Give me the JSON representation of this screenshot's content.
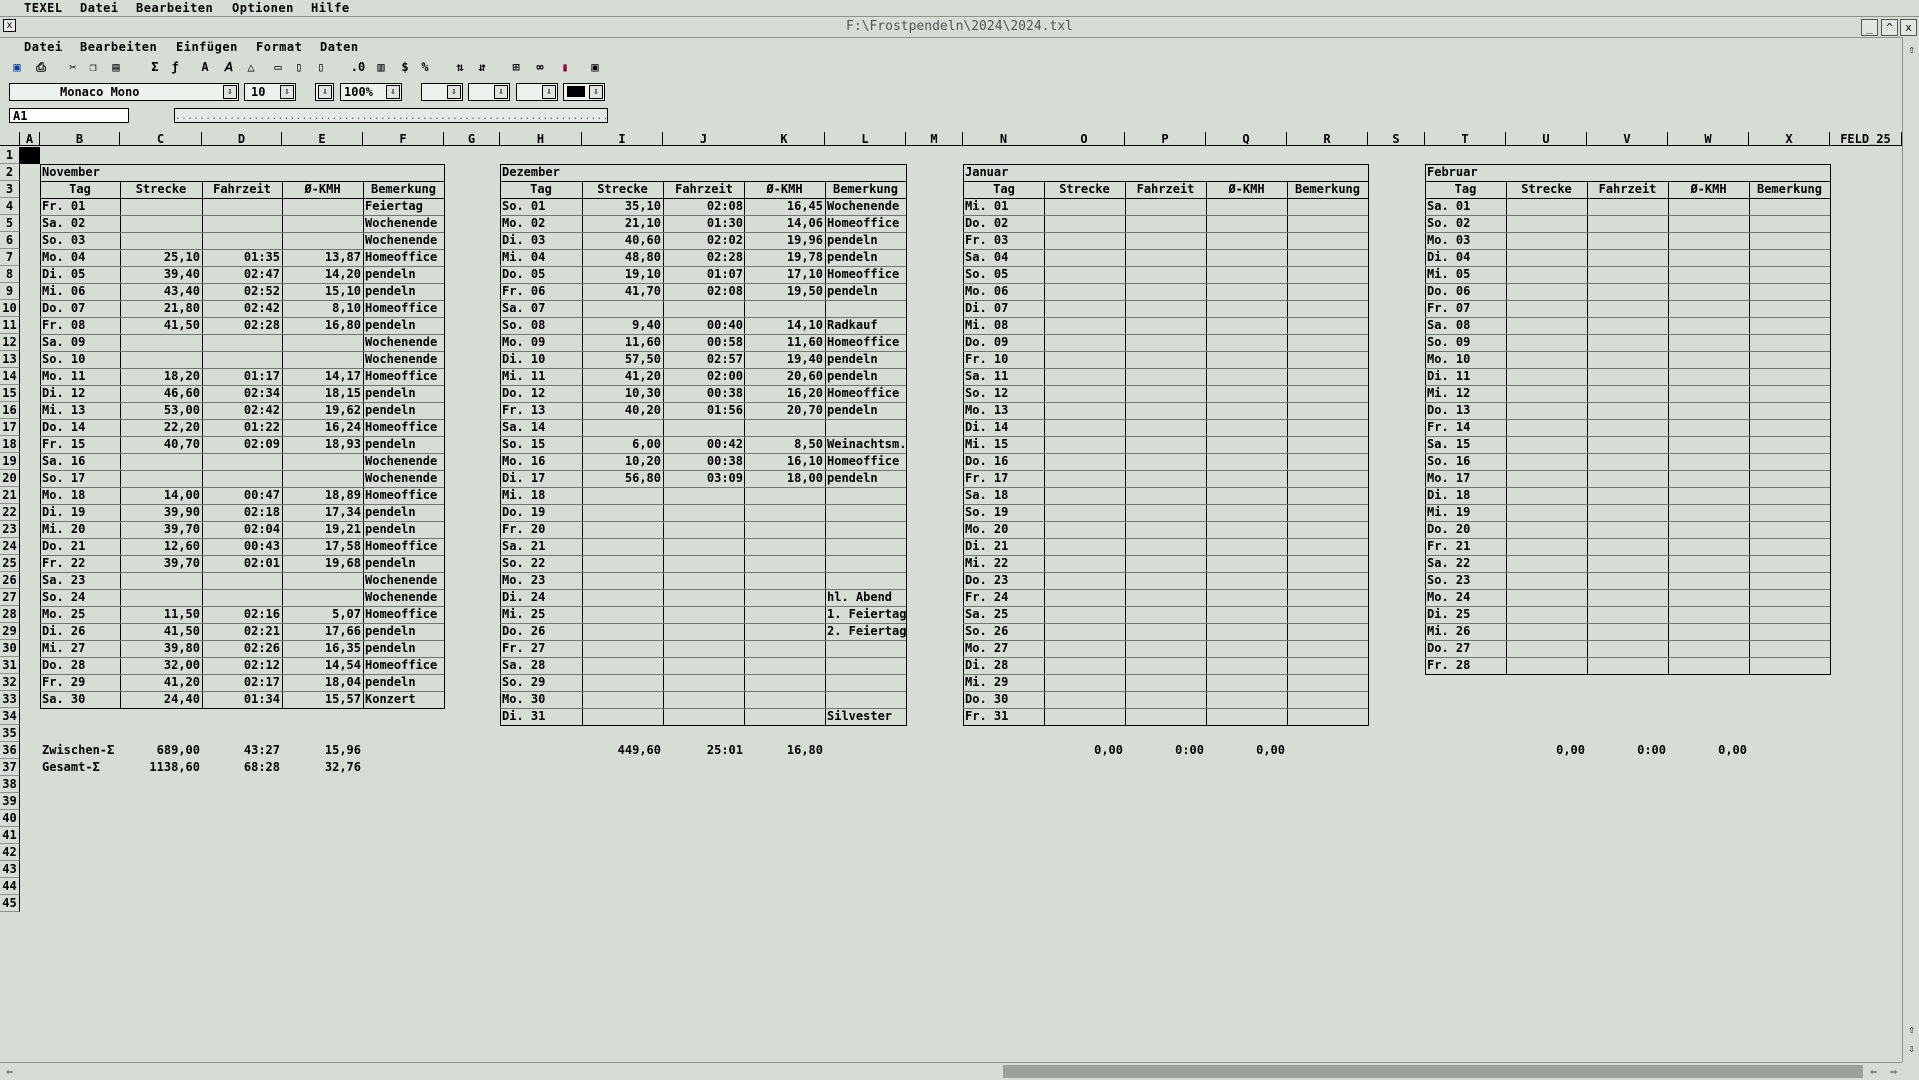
{
  "os_menu": {
    "items": [
      "TEXEL",
      "Datei",
      "Bearbeiten",
      "Optionen",
      "Hilfe"
    ]
  },
  "window": {
    "title": "F:\\Frostpendeln\\2024\\2024.txl",
    "close": "x",
    "min": "_",
    "max": "^",
    "close2": "x"
  },
  "app_menu": {
    "items": [
      "Datei",
      "Bearbeiten",
      "Einfügen",
      "Format",
      "Daten"
    ]
  },
  "format_bar": {
    "font": "Monaco Mono",
    "size": "10",
    "zoom": "100%"
  },
  "cell_ref": "A1",
  "formula_text": "........................................................................................",
  "columns": [
    "A",
    "B",
    "C",
    "D",
    "E",
    "F",
    "G",
    "H",
    "I",
    "J",
    "K",
    "L",
    "M",
    "N",
    "O",
    "P",
    "Q",
    "R",
    "S",
    "T",
    "U",
    "V",
    "W",
    "X",
    "FELD_25"
  ],
  "row_numbers": [
    "1",
    "2",
    "3",
    "4",
    "5",
    "6",
    "7",
    "8",
    "9",
    "10",
    "11",
    "12",
    "13",
    "14",
    "15",
    "16",
    "17",
    "18",
    "19",
    "20",
    "21",
    "22",
    "23",
    "24",
    "25",
    "26",
    "27",
    "28",
    "29",
    "30",
    "31",
    "32",
    "33",
    "34",
    "35",
    "36",
    "37",
    "38",
    "39",
    "40",
    "41",
    "42",
    "43",
    "44",
    "45"
  ],
  "headers": [
    "Tag",
    "Strecke",
    "Fahrzeit",
    "Ø-KMH",
    "Bemerkung"
  ],
  "months": [
    {
      "name": "November",
      "rows": [
        [
          "Fr. 01",
          "",
          "",
          "",
          "Feiertag"
        ],
        [
          "Sa. 02",
          "",
          "",
          "",
          "Wochenende"
        ],
        [
          "So. 03",
          "",
          "",
          "",
          "Wochenende"
        ],
        [
          "Mo. 04",
          "25,10",
          "01:35",
          "13,87",
          "Homeoffice"
        ],
        [
          "Di. 05",
          "39,40",
          "02:47",
          "14,20",
          "pendeln"
        ],
        [
          "Mi. 06",
          "43,40",
          "02:52",
          "15,10",
          "pendeln"
        ],
        [
          "Do. 07",
          "21,80",
          "02:42",
          "8,10",
          "Homeoffice"
        ],
        [
          "Fr. 08",
          "41,50",
          "02:28",
          "16,80",
          "pendeln"
        ],
        [
          "Sa. 09",
          "",
          "",
          "",
          "Wochenende"
        ],
        [
          "So. 10",
          "",
          "",
          "",
          "Wochenende"
        ],
        [
          "Mo. 11",
          "18,20",
          "01:17",
          "14,17",
          "Homeoffice"
        ],
        [
          "Di. 12",
          "46,60",
          "02:34",
          "18,15",
          "pendeln"
        ],
        [
          "Mi. 13",
          "53,00",
          "02:42",
          "19,62",
          "pendeln"
        ],
        [
          "Do. 14",
          "22,20",
          "01:22",
          "16,24",
          "Homeoffice"
        ],
        [
          "Fr. 15",
          "40,70",
          "02:09",
          "18,93",
          "pendeln"
        ],
        [
          "Sa. 16",
          "",
          "",
          "",
          "Wochenende"
        ],
        [
          "So. 17",
          "",
          "",
          "",
          "Wochenende"
        ],
        [
          "Mo. 18",
          "14,00",
          "00:47",
          "18,89",
          "Homeoffice"
        ],
        [
          "Di. 19",
          "39,90",
          "02:18",
          "17,34",
          "pendeln"
        ],
        [
          "Mi. 20",
          "39,70",
          "02:04",
          "19,21",
          "pendeln"
        ],
        [
          "Do. 21",
          "12,60",
          "00:43",
          "17,58",
          "Homeoffice"
        ],
        [
          "Fr. 22",
          "39,70",
          "02:01",
          "19,68",
          "pendeln"
        ],
        [
          "Sa. 23",
          "",
          "",
          "",
          "Wochenende"
        ],
        [
          "So. 24",
          "",
          "",
          "",
          "Wochenende"
        ],
        [
          "Mo. 25",
          "11,50",
          "02:16",
          "5,07",
          "Homeoffice"
        ],
        [
          "Di. 26",
          "41,50",
          "02:21",
          "17,66",
          "pendeln"
        ],
        [
          "Mi. 27",
          "39,80",
          "02:26",
          "16,35",
          "pendeln"
        ],
        [
          "Do. 28",
          "32,00",
          "02:12",
          "14,54",
          "Homeoffice"
        ],
        [
          "Fr. 29",
          "41,20",
          "02:17",
          "18,04",
          "pendeln"
        ],
        [
          "Sa. 30",
          "24,40",
          "01:34",
          "15,57",
          "Konzert"
        ]
      ],
      "zwischen": [
        "689,00",
        "43:27",
        "15,96"
      ],
      "gesamt": [
        "1138,60",
        "68:28",
        "32,76"
      ]
    },
    {
      "name": "Dezember",
      "rows": [
        [
          "So. 01",
          "35,10",
          "02:08",
          "16,45",
          "Wochenende"
        ],
        [
          "Mo. 02",
          "21,10",
          "01:30",
          "14,06",
          "Homeoffice"
        ],
        [
          "Di. 03",
          "40,60",
          "02:02",
          "19,96",
          "pendeln"
        ],
        [
          "Mi. 04",
          "48,80",
          "02:28",
          "19,78",
          "pendeln"
        ],
        [
          "Do. 05",
          "19,10",
          "01:07",
          "17,10",
          "Homeoffice"
        ],
        [
          "Fr. 06",
          "41,70",
          "02:08",
          "19,50",
          "pendeln"
        ],
        [
          "Sa. 07",
          "",
          "",
          "",
          ""
        ],
        [
          "So. 08",
          "9,40",
          "00:40",
          "14,10",
          "Radkauf"
        ],
        [
          "Mo. 09",
          "11,60",
          "00:58",
          "11,60",
          "Homeoffice"
        ],
        [
          "Di. 10",
          "57,50",
          "02:57",
          "19,40",
          "pendeln"
        ],
        [
          "Mi. 11",
          "41,20",
          "02:00",
          "20,60",
          "pendeln"
        ],
        [
          "Do. 12",
          "10,30",
          "00:38",
          "16,20",
          "Homeoffice"
        ],
        [
          "Fr. 13",
          "40,20",
          "01:56",
          "20,70",
          "pendeln"
        ],
        [
          "Sa. 14",
          "",
          "",
          "",
          ""
        ],
        [
          "So. 15",
          "6,00",
          "00:42",
          "8,50",
          "Weinachtsm."
        ],
        [
          "Mo. 16",
          "10,20",
          "00:38",
          "16,10",
          "Homeoffice"
        ],
        [
          "Di. 17",
          "56,80",
          "03:09",
          "18,00",
          "pendeln"
        ],
        [
          "Mi. 18",
          "",
          "",
          "",
          ""
        ],
        [
          "Do. 19",
          "",
          "",
          "",
          ""
        ],
        [
          "Fr. 20",
          "",
          "",
          "",
          ""
        ],
        [
          "Sa. 21",
          "",
          "",
          "",
          ""
        ],
        [
          "So. 22",
          "",
          "",
          "",
          ""
        ],
        [
          "Mo. 23",
          "",
          "",
          "",
          ""
        ],
        [
          "Di. 24",
          "",
          "",
          "",
          "hl. Abend"
        ],
        [
          "Mi. 25",
          "",
          "",
          "",
          "1. Feiertag"
        ],
        [
          "Do. 26",
          "",
          "",
          "",
          "2. Feiertag"
        ],
        [
          "Fr. 27",
          "",
          "",
          "",
          ""
        ],
        [
          "Sa. 28",
          "",
          "",
          "",
          ""
        ],
        [
          "So. 29",
          "",
          "",
          "",
          ""
        ],
        [
          "Mo. 30",
          "",
          "",
          "",
          ""
        ],
        [
          "Di. 31",
          "",
          "",
          "",
          "Silvester"
        ]
      ],
      "zwischen": [
        "449,60",
        "25:01",
        "16,80"
      ]
    },
    {
      "name": "Januar",
      "rows": [
        [
          "Mi. 01",
          "",
          "",
          "",
          ""
        ],
        [
          "Do. 02",
          "",
          "",
          "",
          ""
        ],
        [
          "Fr. 03",
          "",
          "",
          "",
          ""
        ],
        [
          "Sa. 04",
          "",
          "",
          "",
          ""
        ],
        [
          "So. 05",
          "",
          "",
          "",
          ""
        ],
        [
          "Mo. 06",
          "",
          "",
          "",
          ""
        ],
        [
          "Di. 07",
          "",
          "",
          "",
          ""
        ],
        [
          "Mi. 08",
          "",
          "",
          "",
          ""
        ],
        [
          "Do. 09",
          "",
          "",
          "",
          ""
        ],
        [
          "Fr. 10",
          "",
          "",
          "",
          ""
        ],
        [
          "Sa. 11",
          "",
          "",
          "",
          ""
        ],
        [
          "So. 12",
          "",
          "",
          "",
          ""
        ],
        [
          "Mo. 13",
          "",
          "",
          "",
          ""
        ],
        [
          "Di. 14",
          "",
          "",
          "",
          ""
        ],
        [
          "Mi. 15",
          "",
          "",
          "",
          ""
        ],
        [
          "Do. 16",
          "",
          "",
          "",
          ""
        ],
        [
          "Fr. 17",
          "",
          "",
          "",
          ""
        ],
        [
          "Sa. 18",
          "",
          "",
          "",
          ""
        ],
        [
          "So. 19",
          "",
          "",
          "",
          ""
        ],
        [
          "Mo. 20",
          "",
          "",
          "",
          ""
        ],
        [
          "Di. 21",
          "",
          "",
          "",
          ""
        ],
        [
          "Mi. 22",
          "",
          "",
          "",
          ""
        ],
        [
          "Do. 23",
          "",
          "",
          "",
          ""
        ],
        [
          "Fr. 24",
          "",
          "",
          "",
          ""
        ],
        [
          "Sa. 25",
          "",
          "",
          "",
          ""
        ],
        [
          "So. 26",
          "",
          "",
          "",
          ""
        ],
        [
          "Mo. 27",
          "",
          "",
          "",
          ""
        ],
        [
          "Di. 28",
          "",
          "",
          "",
          ""
        ],
        [
          "Mi. 29",
          "",
          "",
          "",
          ""
        ],
        [
          "Do. 30",
          "",
          "",
          "",
          ""
        ],
        [
          "Fr. 31",
          "",
          "",
          "",
          ""
        ]
      ],
      "zwischen": [
        "0,00",
        "0:00",
        "0,00"
      ]
    },
    {
      "name": "Februar",
      "rows": [
        [
          "Sa. 01",
          "",
          "",
          "",
          ""
        ],
        [
          "So. 02",
          "",
          "",
          "",
          ""
        ],
        [
          "Mo. 03",
          "",
          "",
          "",
          ""
        ],
        [
          "Di. 04",
          "",
          "",
          "",
          ""
        ],
        [
          "Mi. 05",
          "",
          "",
          "",
          ""
        ],
        [
          "Do. 06",
          "",
          "",
          "",
          ""
        ],
        [
          "Fr. 07",
          "",
          "",
          "",
          ""
        ],
        [
          "Sa. 08",
          "",
          "",
          "",
          ""
        ],
        [
          "So. 09",
          "",
          "",
          "",
          ""
        ],
        [
          "Mo. 10",
          "",
          "",
          "",
          ""
        ],
        [
          "Di. 11",
          "",
          "",
          "",
          ""
        ],
        [
          "Mi. 12",
          "",
          "",
          "",
          ""
        ],
        [
          "Do. 13",
          "",
          "",
          "",
          ""
        ],
        [
          "Fr. 14",
          "",
          "",
          "",
          ""
        ],
        [
          "Sa. 15",
          "",
          "",
          "",
          ""
        ],
        [
          "So. 16",
          "",
          "",
          "",
          ""
        ],
        [
          "Mo. 17",
          "",
          "",
          "",
          ""
        ],
        [
          "Di. 18",
          "",
          "",
          "",
          ""
        ],
        [
          "Mi. 19",
          "",
          "",
          "",
          ""
        ],
        [
          "Do. 20",
          "",
          "",
          "",
          ""
        ],
        [
          "Fr. 21",
          "",
          "",
          "",
          ""
        ],
        [
          "Sa. 22",
          "",
          "",
          "",
          ""
        ],
        [
          "So. 23",
          "",
          "",
          "",
          ""
        ],
        [
          "Mo. 24",
          "",
          "",
          "",
          ""
        ],
        [
          "Di. 25",
          "",
          "",
          "",
          ""
        ],
        [
          "Mi. 26",
          "",
          "",
          "",
          ""
        ],
        [
          "Do. 27",
          "",
          "",
          "",
          ""
        ],
        [
          "Fr. 28",
          "",
          "",
          "",
          ""
        ]
      ],
      "zwischen": [
        "0,00",
        "0:00",
        "0,00"
      ]
    }
  ],
  "labels": {
    "zwischen": "Zwischen-Σ",
    "gesamt": "Gesamt-Σ"
  },
  "icons": {
    "toolbar": [
      "save-icon",
      "print-icon",
      "cut-icon",
      "copy-icon",
      "paste-icon",
      "sum-icon",
      "function-icon",
      "font-color-icon",
      "text-style-icon",
      "fill-icon",
      "sheet-icon",
      "sheet2-icon",
      "sheet3-icon",
      "decimal-icon",
      "chart-icon",
      "currency-icon",
      "percent-icon",
      "sort-asc-icon",
      "sort-desc-icon",
      "insert-icon",
      "link-icon",
      "book-icon",
      "window-icon"
    ]
  }
}
